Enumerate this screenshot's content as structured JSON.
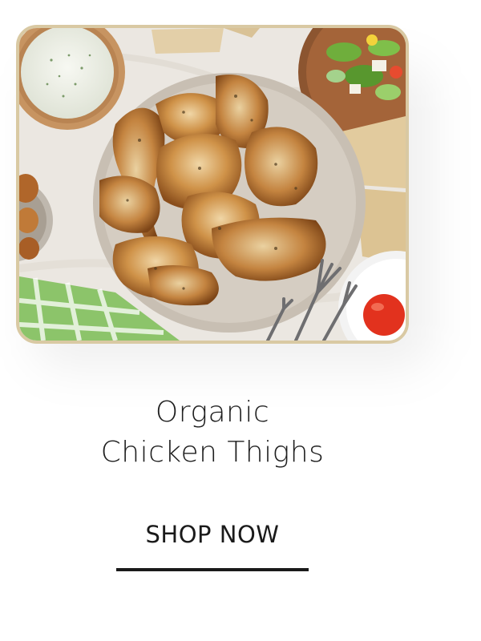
{
  "product": {
    "title_line1": "Organic",
    "title_line2": "Chicken Thighs"
  },
  "cta": {
    "label": "SHOP NOW"
  },
  "image": {
    "subject": "roast-chicken-plate"
  },
  "colors": {
    "frame_border": "#d9c9a3",
    "text": "#1f1f1f",
    "underline": "#1a1a1a",
    "background": "#ffffff"
  }
}
